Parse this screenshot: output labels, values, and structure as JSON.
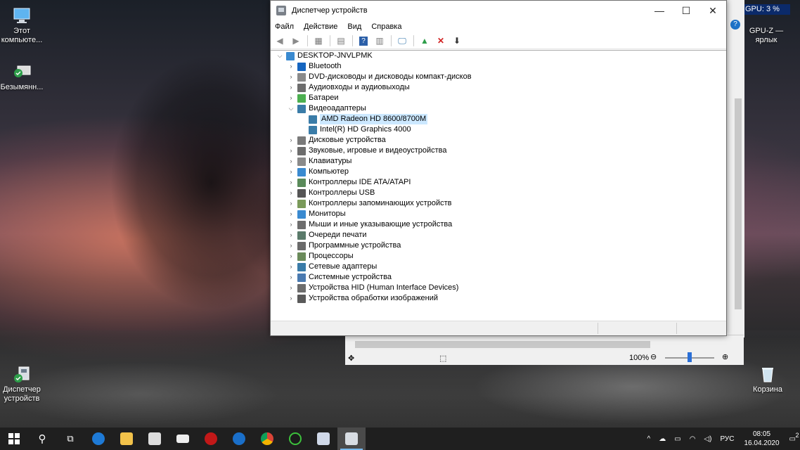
{
  "desktop": {
    "icons": [
      {
        "label": "Этот компьюте..."
      },
      {
        "label": "Безымянн..."
      },
      {
        "label": "Диспетчер устройств"
      },
      {
        "label": "GPU-Z — ярлык"
      },
      {
        "label": "Корзина"
      }
    ],
    "gpu_widget": "GPU: 3 %"
  },
  "window": {
    "title": "Диспетчер устройств",
    "controls": {
      "minimize": "—",
      "maximize": "☐",
      "close": "✕"
    },
    "menu": [
      "Файл",
      "Действие",
      "Вид",
      "Справка"
    ],
    "tree": {
      "root": "DESKTOP-JNVLPMK",
      "categories": [
        {
          "label": "Bluetooth",
          "icon": "bluetooth-icon",
          "color": "#1565c0"
        },
        {
          "label": "DVD-дисководы и дисководы компакт-дисков",
          "icon": "dvd-drive-icon",
          "color": "#8a8a8a"
        },
        {
          "label": "Аудиовходы и аудиовыходы",
          "icon": "speaker-icon",
          "color": "#6d6d6d"
        },
        {
          "label": "Батареи",
          "icon": "battery-icon",
          "color": "#4caf50"
        },
        {
          "label": "Видеоадаптеры",
          "icon": "display-adapter-icon",
          "color": "#3a7ca8",
          "expanded": true,
          "children": [
            {
              "label": "AMD Radeon HD 8600/8700M",
              "selected": true
            },
            {
              "label": "Intel(R) HD Graphics 4000",
              "selected": false
            }
          ]
        },
        {
          "label": "Дисковые устройства",
          "icon": "disk-drive-icon",
          "color": "#7a7a7a"
        },
        {
          "label": "Звуковые, игровые и видеоустройства",
          "icon": "sound-device-icon",
          "color": "#6d6d6d"
        },
        {
          "label": "Клавиатуры",
          "icon": "keyboard-icon",
          "color": "#8a8a8a"
        },
        {
          "label": "Компьютер",
          "icon": "computer-icon",
          "color": "#3a8ad0"
        },
        {
          "label": "Контроллеры IDE ATA/ATAPI",
          "icon": "ide-controller-icon",
          "color": "#5a8a5a"
        },
        {
          "label": "Контроллеры USB",
          "icon": "usb-icon",
          "color": "#555555"
        },
        {
          "label": "Контроллеры запоминающих устройств",
          "icon": "storage-controller-icon",
          "color": "#7a9a5a"
        },
        {
          "label": "Мониторы",
          "icon": "monitor-icon",
          "color": "#3a8ad0"
        },
        {
          "label": "Мыши и иные указывающие устройства",
          "icon": "mouse-icon",
          "color": "#6d6d6d"
        },
        {
          "label": "Очереди печати",
          "icon": "printer-icon",
          "color": "#5a7a6a"
        },
        {
          "label": "Программные устройства",
          "icon": "software-device-icon",
          "color": "#6a6a6a"
        },
        {
          "label": "Процессоры",
          "icon": "processor-icon",
          "color": "#6a8a5a"
        },
        {
          "label": "Сетевые адаптеры",
          "icon": "network-adapter-icon",
          "color": "#3a7ca8"
        },
        {
          "label": "Системные устройства",
          "icon": "system-device-icon",
          "color": "#4a7ab0"
        },
        {
          "label": "Устройства HID (Human Interface Devices)",
          "icon": "hid-icon",
          "color": "#6d6d6d"
        },
        {
          "label": "Устройства обработки изображений",
          "icon": "imaging-device-icon",
          "color": "#5a5a5a"
        }
      ]
    }
  },
  "background_window": {
    "zoom": "100%",
    "zoom_level_percent": 50
  },
  "taskbar": {
    "lang": "РУС",
    "time": "08:05",
    "date": "16.04.2020",
    "notification_count": "2"
  },
  "colors": {
    "selection": "#cce8ff",
    "taskbar": "#1f1f1f",
    "accent": "#76b9ed"
  }
}
